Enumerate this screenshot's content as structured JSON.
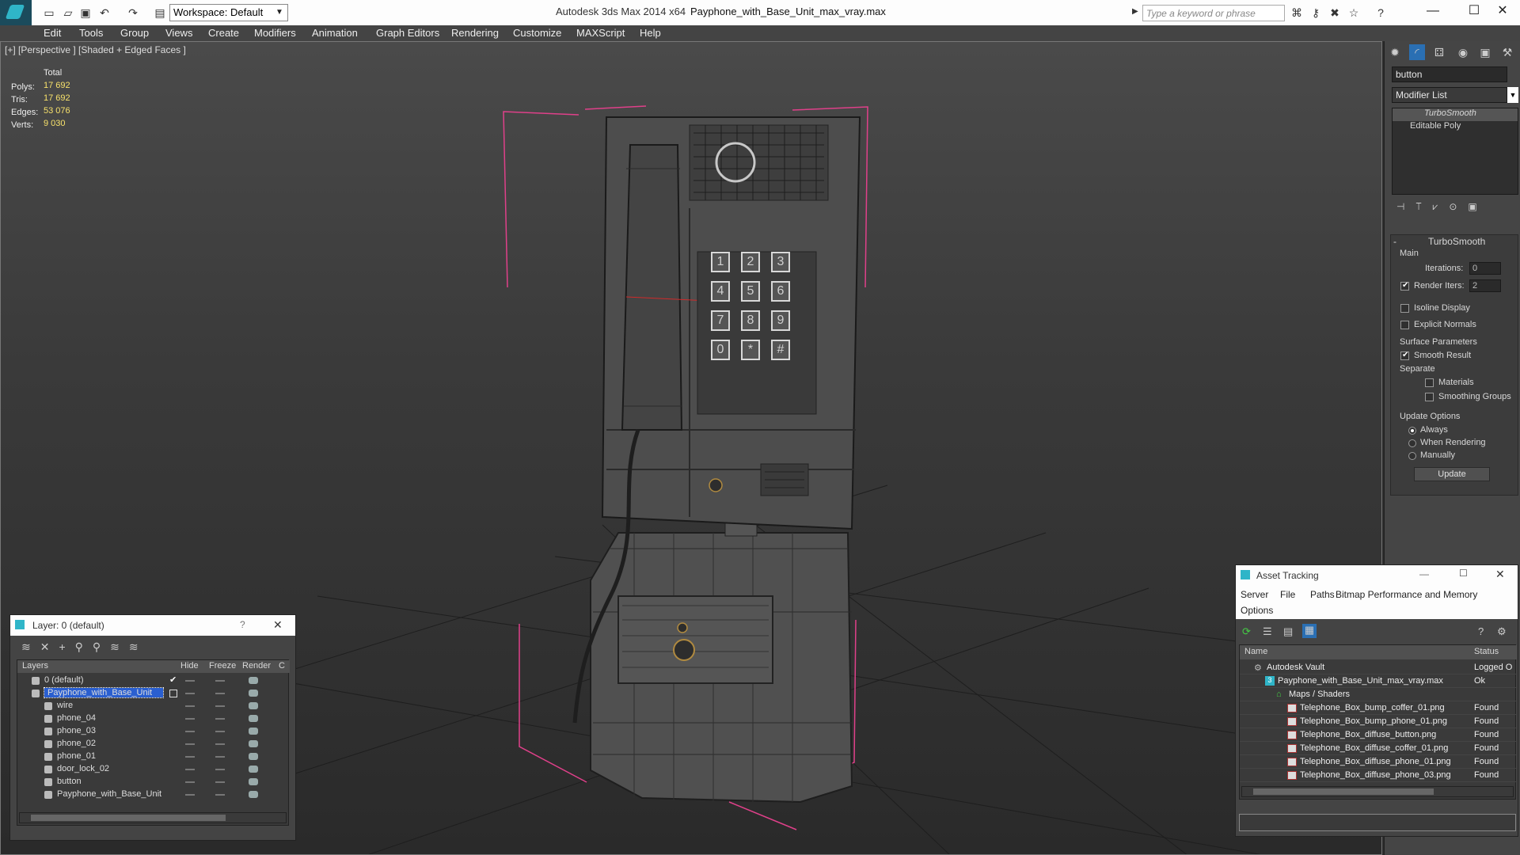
{
  "window": {
    "app_title": "Autodesk 3ds Max  2014 x64",
    "file_title": "Payphone_with_Base_Unit_max_vray.max",
    "workspace": "Workspace: Default",
    "search_placeholder": "Type a keyword or phrase"
  },
  "menu": [
    "Edit",
    "Tools",
    "Group",
    "Views",
    "Create",
    "Modifiers",
    "Animation",
    "Graph Editors",
    "Rendering",
    "Customize",
    "MAXScript",
    "Help"
  ],
  "viewport": {
    "label": "[+] [Perspective ] [Shaded + Edged Faces ]",
    "stats": {
      "header": "Total",
      "rows": [
        {
          "label": "Polys:",
          "value": "17 692"
        },
        {
          "label": "Tris:",
          "value": "17 692"
        },
        {
          "label": "Edges:",
          "value": "53 076"
        },
        {
          "label": "Verts:",
          "value": "9 030"
        }
      ]
    },
    "keypad": [
      "1",
      "2",
      "3",
      "4",
      "5",
      "6",
      "7",
      "8",
      "9",
      "0",
      "*",
      "#"
    ]
  },
  "command_panel": {
    "object_name": "button",
    "modifier_list": "Modifier List",
    "stack": [
      "TurboSmooth",
      "Editable Poly"
    ],
    "rollout_title": "TurboSmooth",
    "main_label": "Main",
    "iterations_label": "Iterations:",
    "iterations_value": "0",
    "render_iters_label": "Render Iters:",
    "render_iters_value": "2",
    "isoline": "Isoline Display",
    "explicit_normals": "Explicit Normals",
    "surface_params": "Surface Parameters",
    "smooth_result": "Smooth Result",
    "separate": "Separate",
    "materials": "Materials",
    "smoothing_groups": "Smoothing Groups",
    "update_options": "Update Options",
    "always": "Always",
    "when_rendering": "When Rendering",
    "manually": "Manually",
    "update_button": "Update",
    "minus": "-"
  },
  "layer_window": {
    "title": "Layer: 0 (default)",
    "question": "?",
    "close": "✕",
    "columns": [
      "Layers",
      "Hide",
      "Freeze",
      "Render",
      "C"
    ],
    "rows": [
      {
        "name": "0 (default)",
        "indent": 0,
        "selected": false,
        "checked": true
      },
      {
        "name": "Payphone_with_Base_Unit",
        "indent": 0,
        "selected": true,
        "checked": false
      },
      {
        "name": "wire",
        "indent": 1
      },
      {
        "name": "phone_04",
        "indent": 1
      },
      {
        "name": "phone_03",
        "indent": 1
      },
      {
        "name": "phone_02",
        "indent": 1
      },
      {
        "name": "phone_01",
        "indent": 1
      },
      {
        "name": "door_lock_02",
        "indent": 1
      },
      {
        "name": "button",
        "indent": 1
      },
      {
        "name": "Payphone_with_Base_Unit",
        "indent": 1
      }
    ]
  },
  "asset_window": {
    "title": "Asset Tracking",
    "menu": [
      "Server",
      "File",
      "Paths",
      "Bitmap Performance and Memory",
      "Options"
    ],
    "columns": [
      "Name",
      "Status"
    ],
    "rows": [
      {
        "name": "Autodesk Vault",
        "status": "Logged O",
        "indent": 0
      },
      {
        "name": "Payphone_with_Base_Unit_max_vray.max",
        "status": "Ok",
        "indent": 1
      },
      {
        "name": "Maps / Shaders",
        "status": "",
        "indent": 2
      },
      {
        "name": "Telephone_Box_bump_coffer_01.png",
        "status": "Found",
        "indent": 3
      },
      {
        "name": "Telephone_Box_bump_phone_01.png",
        "status": "Found",
        "indent": 3
      },
      {
        "name": "Telephone_Box_diffuse_button.png",
        "status": "Found",
        "indent": 3
      },
      {
        "name": "Telephone_Box_diffuse_coffer_01.png",
        "status": "Found",
        "indent": 3
      },
      {
        "name": "Telephone_Box_diffuse_phone_01.png",
        "status": "Found",
        "indent": 3
      },
      {
        "name": "Telephone_Box_diffuse_phone_03.png",
        "status": "Found",
        "indent": 3
      }
    ]
  },
  "colors": {
    "selection": "#2a5fd0",
    "bbox": "#e0408a",
    "stat_value": "#f7e16b"
  }
}
